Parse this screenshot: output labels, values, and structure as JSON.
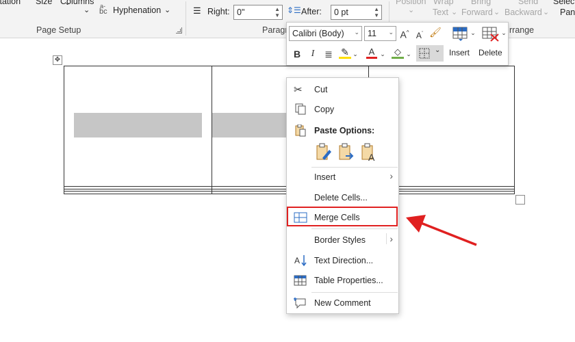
{
  "ribbon": {
    "orientation_partial": "Orientation",
    "size_label": "Size",
    "columns_label": "Columns",
    "hyphenation_label": "Hyphenation",
    "hyphenation_prefix": "bc",
    "hyphenation_sup": "a-",
    "page_setup_group": "Page Setup",
    "right_label": "Right:",
    "right_value": "0\"",
    "after_label": "After:",
    "after_value": "0 pt",
    "paragraph_group": "Paragraph",
    "position_label": "Position",
    "wrap_text_label": "Wrap Text",
    "bring_forward_label": "Bring Forward",
    "send_backward_label": "Send Backward",
    "selection_pane_label": "Selection Pane",
    "arrange_group": "Arrange",
    "wrap": "Wrap",
    "text": "Text",
    "bring": "Bring",
    "forward": "Forward",
    "send": "Send",
    "backward": "Backward",
    "selec": "Selec",
    "pan": "Pan",
    "arrange_partial": "rrange"
  },
  "mini_toolbar": {
    "font_name": "Calibri (Body)",
    "font_size": "11",
    "bold": "B",
    "italic": "I",
    "insert_label": "Insert",
    "delete_label": "Delete"
  },
  "context_menu": {
    "cut": "Cut",
    "copy": "Copy",
    "paste_options": "Paste Options:",
    "insert": "Insert",
    "delete_cells": "Delete Cells...",
    "merge_cells": "Merge Cells",
    "border_styles": "Border Styles",
    "text_direction": "Text Direction...",
    "table_properties": "Table Properties...",
    "new_comment": "New Comment"
  },
  "colors": {
    "highlight_box": "#e02020",
    "font_color": "#e02020",
    "selected_cell": "#c6c6c6"
  }
}
